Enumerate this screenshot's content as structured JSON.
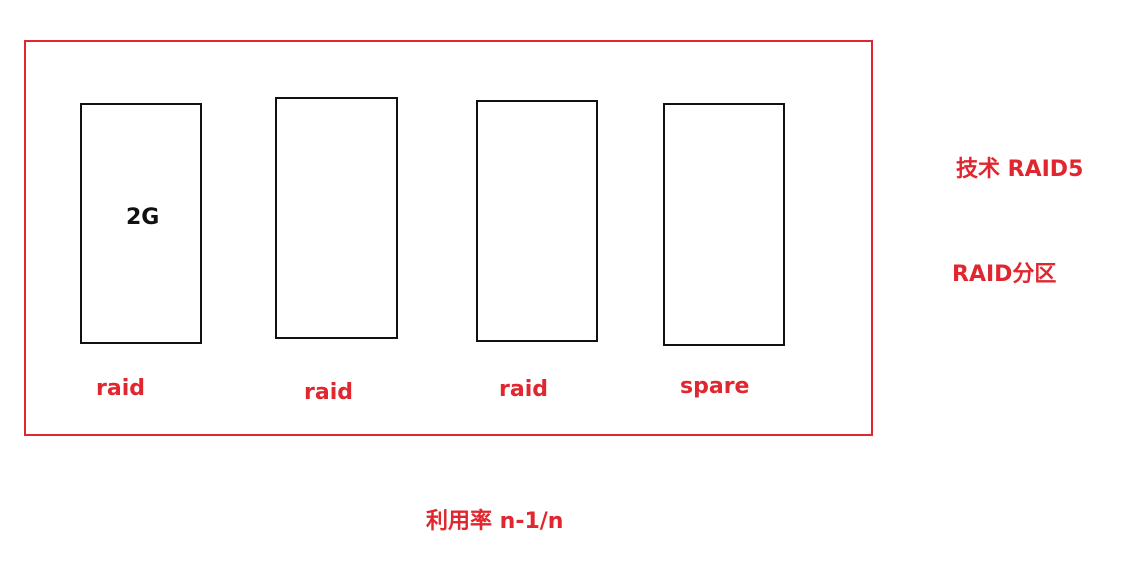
{
  "disks": [
    {
      "label": "raid",
      "capacity": "2G"
    },
    {
      "label": "raid",
      "capacity": ""
    },
    {
      "label": "raid",
      "capacity": ""
    },
    {
      "label": "spare",
      "capacity": ""
    }
  ],
  "side_labels": {
    "technology": "技术 RAID5",
    "partition": "RAID分区"
  },
  "footer": {
    "utilization": "利用率  n-1/n"
  },
  "colors": {
    "accent": "#e0262e",
    "disk_border": "#111111",
    "background": "#ffffff"
  }
}
